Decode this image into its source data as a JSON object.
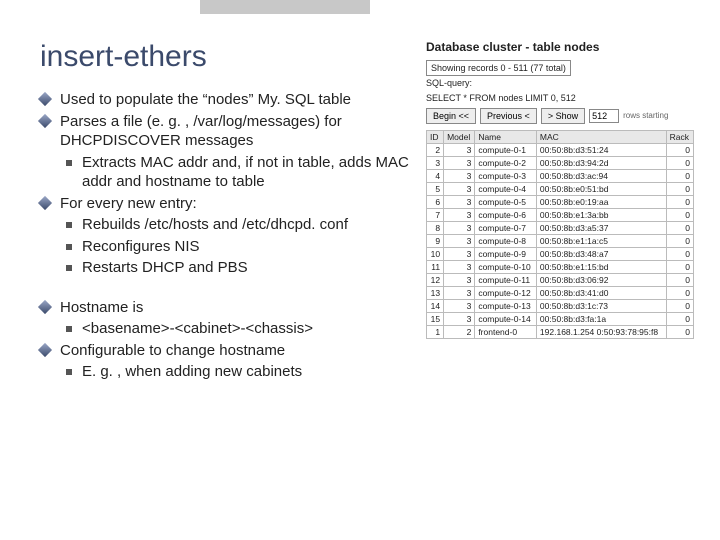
{
  "title": "insert-ethers",
  "bullets": {
    "b1": "Used to populate the “nodes” My. SQL table",
    "b2": "Parses a file (e. g. , /var/log/messages) for DHCPDISCOVER messages",
    "b2_1": "Extracts MAC addr and, if not in table, adds MAC addr and hostname to table",
    "b3": "For every new entry:",
    "b3_1": "Rebuilds /etc/hosts and /etc/dhcpd. conf",
    "b3_2": "Reconfigures NIS",
    "b3_3": "Restarts DHCP and PBS",
    "b4": "Hostname is",
    "b4_1": "<basename>-<cabinet>-<chassis>",
    "b5": "Configurable to change hostname",
    "b5_1": "E. g. , when adding new cabinets"
  },
  "db": {
    "title": "Database cluster - table nodes",
    "records": "Showing records 0 - 511 (77 total)",
    "sql1": "SQL-query:",
    "sql2": "SELECT * FROM nodes LIMIT 0, 512",
    "begin": "Begin <<",
    "prev": "Previous <",
    "show": "> Show",
    "limit": "512",
    "trail": "rows starting",
    "cols": {
      "c1": "ID",
      "c2": "Model",
      "c3": "Name",
      "c4": "MAC",
      "c5": "Rack"
    }
  },
  "rows": [
    {
      "id": "2",
      "model": "3",
      "name": "compute-0-1",
      "mac": "00:50:8b:d3:51:24",
      "rack": "0"
    },
    {
      "id": "3",
      "model": "3",
      "name": "compute-0-2",
      "mac": "00:50:8b:d3:94:2d",
      "rack": "0"
    },
    {
      "id": "4",
      "model": "3",
      "name": "compute-0-3",
      "mac": "00:50:8b:d3:ac:94",
      "rack": "0"
    },
    {
      "id": "5",
      "model": "3",
      "name": "compute-0-4",
      "mac": "00:50:8b:e0:51:bd",
      "rack": "0"
    },
    {
      "id": "6",
      "model": "3",
      "name": "compute-0-5",
      "mac": "00:50:8b:e0:19:aa",
      "rack": "0"
    },
    {
      "id": "7",
      "model": "3",
      "name": "compute-0-6",
      "mac": "00:50:8b:e1:3a:bb",
      "rack": "0"
    },
    {
      "id": "8",
      "model": "3",
      "name": "compute-0-7",
      "mac": "00:50:8b:d3:a5:37",
      "rack": "0"
    },
    {
      "id": "9",
      "model": "3",
      "name": "compute-0-8",
      "mac": "00:50:8b:e1:1a:c5",
      "rack": "0"
    },
    {
      "id": "10",
      "model": "3",
      "name": "compute-0-9",
      "mac": "00:50:8b:d3:48:a7",
      "rack": "0"
    },
    {
      "id": "11",
      "model": "3",
      "name": "compute-0-10",
      "mac": "00:50:8b:e1:15:bd",
      "rack": "0"
    },
    {
      "id": "12",
      "model": "3",
      "name": "compute-0-11",
      "mac": "00:50:8b:d3:06:92",
      "rack": "0"
    },
    {
      "id": "13",
      "model": "3",
      "name": "compute-0-12",
      "mac": "00:50:8b:d3:41:d0",
      "rack": "0"
    },
    {
      "id": "14",
      "model": "3",
      "name": "compute-0-13",
      "mac": "00:50:8b:d3:1c:73",
      "rack": "0"
    },
    {
      "id": "15",
      "model": "3",
      "name": "compute-0-14",
      "mac": "00:50:8b:d3:fa:1a",
      "rack": "0"
    },
    {
      "id": "1",
      "model": "2",
      "name": "frontend-0",
      "mac": "192.168.1.254  0:50:93:78:95:f8",
      "rack": "0"
    }
  ]
}
